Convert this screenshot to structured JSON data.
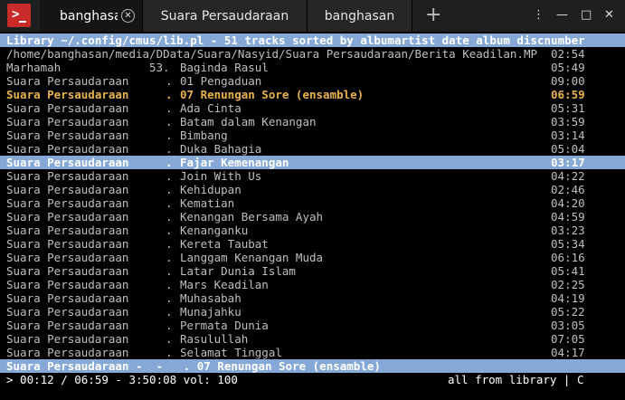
{
  "tabs": [
    {
      "label": "banghasan",
      "close": "✕"
    },
    {
      "label": "Suara Persaudaraan"
    },
    {
      "label": "banghasan"
    }
  ],
  "add_tab": "+",
  "window_controls": {
    "menu": "⋮",
    "minimize": "—",
    "maximize": "□",
    "close": "✕"
  },
  "app_icon_glyph": ">",
  "header": "Library ~/.config/cmus/lib.pl - 51 tracks sorted by albumartist date album discnumber",
  "path_line": {
    "path": "/home/banghasan/media/DData/Suara/Nasyid/Suara Persaudaraan/Berita Keadilan.MP",
    "time": "02:54"
  },
  "tracks": [
    {
      "artist": "Marhamah",
      "num": "53.",
      "title": "Baginda Rasul",
      "time": "05:49",
      "state": "normal"
    },
    {
      "artist": "Suara Persaudaraan",
      "num": ".",
      "title": "01 Pengaduan",
      "time": "09:00",
      "state": "normal"
    },
    {
      "artist": "Suara Persaudaraan",
      "num": ".",
      "title": "07 Renungan Sore (ensamble)",
      "time": "06:59",
      "state": "playing"
    },
    {
      "artist": "Suara Persaudaraan",
      "num": ".",
      "title": "Ada Cinta",
      "time": "05:31",
      "state": "normal"
    },
    {
      "artist": "Suara Persaudaraan",
      "num": ".",
      "title": "Batam dalam Kenangan",
      "time": "03:59",
      "state": "normal"
    },
    {
      "artist": "Suara Persaudaraan",
      "num": ".",
      "title": "Bimbang",
      "time": "03:14",
      "state": "normal"
    },
    {
      "artist": "Suara Persaudaraan",
      "num": ".",
      "title": "Duka Bahagia",
      "time": "05:04",
      "state": "normal"
    },
    {
      "artist": "Suara Persaudaraan",
      "num": ".",
      "title": "Fajar Kemenangan",
      "time": "03:17",
      "state": "selected"
    },
    {
      "artist": "Suara Persaudaraan",
      "num": ".",
      "title": "Join With Us",
      "time": "04:22",
      "state": "normal"
    },
    {
      "artist": "Suara Persaudaraan",
      "num": ".",
      "title": "Kehidupan",
      "time": "02:46",
      "state": "normal"
    },
    {
      "artist": "Suara Persaudaraan",
      "num": ".",
      "title": "Kematian",
      "time": "04:20",
      "state": "normal"
    },
    {
      "artist": "Suara Persaudaraan",
      "num": ".",
      "title": "Kenangan Bersama Ayah",
      "time": "04:59",
      "state": "normal"
    },
    {
      "artist": "Suara Persaudaraan",
      "num": ".",
      "title": "Kenanganku",
      "time": "03:23",
      "state": "normal"
    },
    {
      "artist": "Suara Persaudaraan",
      "num": ".",
      "title": "Kereta Taubat",
      "time": "05:34",
      "state": "normal"
    },
    {
      "artist": "Suara Persaudaraan",
      "num": ".",
      "title": "Langgam Kenangan Muda",
      "time": "06:16",
      "state": "normal"
    },
    {
      "artist": "Suara Persaudaraan",
      "num": ".",
      "title": "Latar Dunia Islam",
      "time": "05:41",
      "state": "normal"
    },
    {
      "artist": "Suara Persaudaraan",
      "num": ".",
      "title": "Mars Keadilan",
      "time": "02:25",
      "state": "normal"
    },
    {
      "artist": "Suara Persaudaraan",
      "num": ".",
      "title": "Muhasabah",
      "time": "04:19",
      "state": "normal"
    },
    {
      "artist": "Suara Persaudaraan",
      "num": ".",
      "title": "Munajahku",
      "time": "05:22",
      "state": "normal"
    },
    {
      "artist": "Suara Persaudaraan",
      "num": ".",
      "title": "Permata Dunia",
      "time": "03:05",
      "state": "normal"
    },
    {
      "artist": "Suara Persaudaraan",
      "num": ".",
      "title": "Rasulullah",
      "time": "07:05",
      "state": "normal"
    },
    {
      "artist": "Suara Persaudaraan",
      "num": ".",
      "title": "Selamat Tinggal",
      "time": "04:17",
      "state": "normal"
    }
  ],
  "now_playing": "Suara Persaudaraan -  -   . 07 Renungan Sore (ensamble)",
  "status_bar": {
    "left": "> 00:12 / 06:59 - 3:50:08 vol: 100",
    "right": "all from library | C"
  },
  "colors": {
    "header_bg": "#86a8d6",
    "playing": "#e9b24a",
    "text": "#bfbfbf",
    "background": "#000000"
  }
}
